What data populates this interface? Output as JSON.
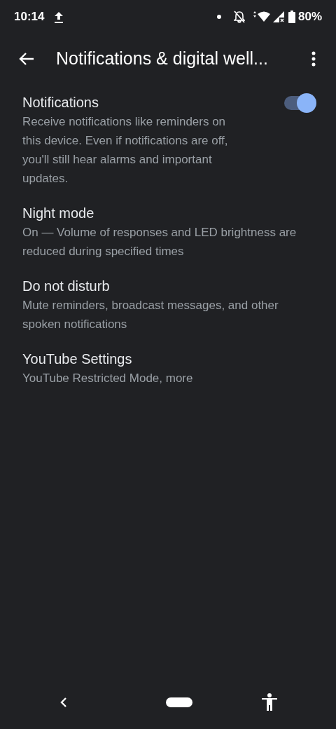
{
  "status_bar": {
    "time": "10:14",
    "battery": "80%"
  },
  "app_bar": {
    "title": "Notifications & digital well..."
  },
  "settings": [
    {
      "kind": "toggle",
      "title": "Notifications",
      "subtitle": "Receive notifications like reminders on this device. Even if notifications are off, you'll still hear alarms and important updates.",
      "on": true
    },
    {
      "kind": "link",
      "title": "Night mode",
      "subtitle": "On — Volume of responses and LED brightness are reduced during specified times"
    },
    {
      "kind": "link",
      "title": "Do not disturb",
      "subtitle": "Mute reminders, broadcast messages, and other spoken notifications"
    },
    {
      "kind": "link",
      "title": "YouTube Settings",
      "subtitle": "YouTube Restricted Mode, more"
    }
  ]
}
